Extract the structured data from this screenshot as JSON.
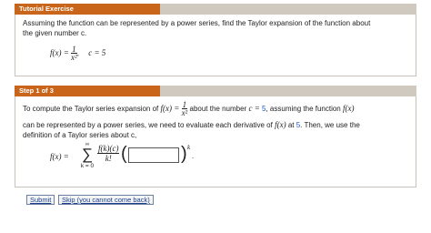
{
  "exercise": {
    "header": "Tutorial Exercise",
    "prompt_line1": "Assuming the function can be represented by a power series, find the Taylor expansion of the function about",
    "prompt_line2": "the given number c.",
    "fx_label": "f(x) =",
    "fx_numerator": "1",
    "fx_denominator": "x²",
    "sep": ",",
    "c_value": "c = 5"
  },
  "step": {
    "header": "Step 1 of 3",
    "line1_a": "To compute the Taylor series expansion of",
    "line1_fx": "f(x) =",
    "line1_num": "1",
    "line1_den": "x²",
    "line1_b": "about the number",
    "line1_c": "c = ",
    "line1_c_value": "5",
    "line1_d": ", assuming the function",
    "line1_fx2": "f(x)",
    "line2_a": "can be represented by a power series, we need to evaluate each derivative of",
    "line2_fx": "f(x)",
    "line2_at": "at",
    "line2_value": "5",
    "line2_b": ". Then, we use the",
    "line3": "definition of a Taylor series about c,",
    "series_lhs": "f(x) =",
    "sum_top": "∞",
    "sum_symbol": "∑",
    "sum_bottom": "k = 0",
    "coef_num": "f(k)(c)",
    "coef_den": "k!",
    "open_paren": "(",
    "close_paren": ")",
    "power": "k",
    "period": ".",
    "answer_value": ""
  },
  "buttons": {
    "submit": "Submit",
    "skip": "Skip (you cannot come back)"
  },
  "colors": {
    "accent": "#c8651a",
    "bar": "#cfc9c0",
    "link": "#1a56c8"
  }
}
